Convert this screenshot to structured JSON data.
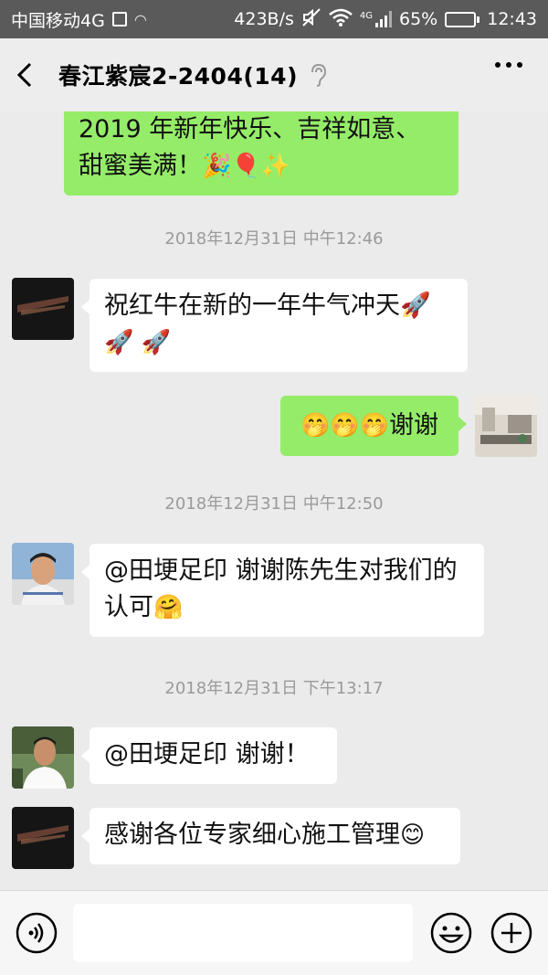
{
  "status_bar": {
    "carrier": "中国移动4G",
    "net_speed": "423B/s",
    "network_type": "4G",
    "battery_percent": "65%",
    "battery_level": 0.65,
    "time": "12:43"
  },
  "header": {
    "title": "春江紫宸2-2404(14)"
  },
  "messages": [
    {
      "side": "right",
      "text": "2019 年新年快乐、吉祥如意、甜蜜美满！",
      "emoji": "🎉🎈✨"
    },
    {
      "type": "time",
      "text": "2018年12月31日 中午12:46"
    },
    {
      "side": "left",
      "text": "祝红牛在新的一年牛气冲天🚀",
      "emoji": "🚀 🚀"
    },
    {
      "side": "right",
      "emoji": "🤭🤭🤭",
      "text": "谢谢"
    },
    {
      "type": "time",
      "text": "2018年12月31日 中午12:50"
    },
    {
      "side": "left",
      "text": "@田埂足印  谢谢陈先生对我们的认可",
      "emoji": "🤗"
    },
    {
      "type": "time",
      "text": "2018年12月31日 下午13:17"
    },
    {
      "side": "left",
      "text": "@田埂足印  谢谢！"
    },
    {
      "side": "left",
      "text": "感谢各位专家细心施工管理",
      "emoji": "😊"
    }
  ],
  "input": {
    "value": "",
    "placeholder": ""
  },
  "colors": {
    "status_bar_bg": "#5a5a5a",
    "chat_bg": "#ebebeb",
    "my_bubble": "#95ec69",
    "their_bubble": "#ffffff",
    "timestamp_text": "#9a9a9a"
  },
  "icons": {
    "back": "back-arrow-icon",
    "ear": "ear-icon",
    "more": "more-dots-icon",
    "voice": "voice-icon",
    "emoji": "emoji-face-icon",
    "plus": "plus-circle-icon"
  }
}
